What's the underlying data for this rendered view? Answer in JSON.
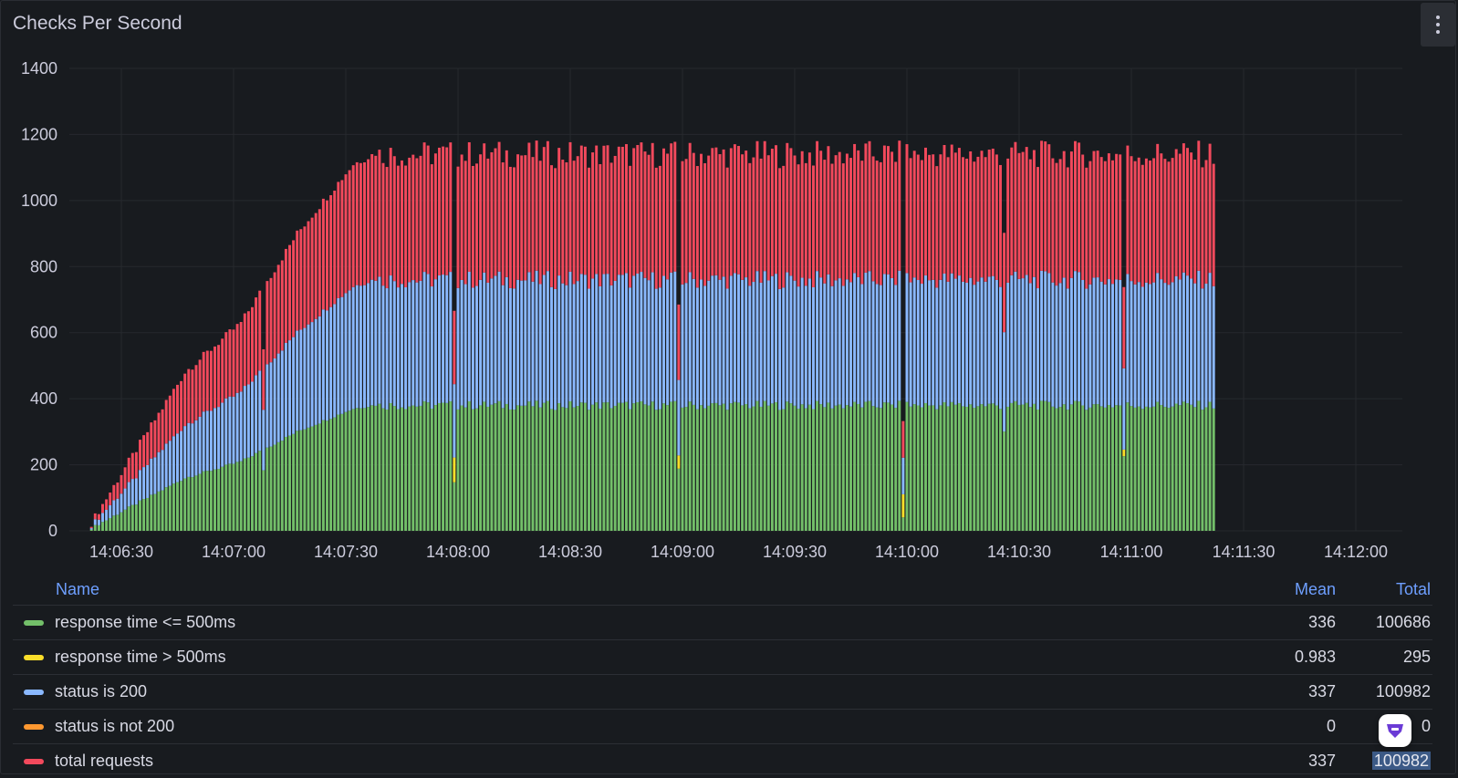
{
  "panel": {
    "title": "Checks Per Second"
  },
  "colors": {
    "green": "#73bf69",
    "yellow": "#fade2a",
    "blue": "#8ab8ff",
    "orange": "#ff9830",
    "red": "#f2495c",
    "accent": "#6e9fff"
  },
  "icons": {
    "menu": "vertical-ellipsis-icon",
    "assistant": "assistant-logo-icon"
  },
  "chart_data": {
    "type": "bar",
    "stacked": true,
    "x_ticks": [
      "14:06:30",
      "14:07:00",
      "14:07:30",
      "14:08:00",
      "14:08:30",
      "14:09:00",
      "14:09:30",
      "14:10:00",
      "14:10:30",
      "14:11:00",
      "14:11:30",
      "14:12:00"
    ],
    "y_ticks": [
      "0",
      "200",
      "400",
      "600",
      "800",
      "1000",
      "1200",
      "1400"
    ],
    "ylim": [
      0,
      1400
    ],
    "grid": true,
    "bucket_seconds": 1,
    "start_time": "14:06:22",
    "end_time": "14:11:22",
    "series": [
      {
        "name": "response time <= 500ms",
        "color": "#73bf69",
        "ramp": [
          [
            0,
            8
          ],
          [
            10,
            70
          ],
          [
            25,
            160
          ],
          [
            40,
            210
          ],
          [
            55,
            300
          ],
          [
            70,
            370
          ],
          [
            78,
            385
          ]
        ],
        "plateau": 380
      },
      {
        "name": "response time > 500ms",
        "color": "#fade2a",
        "spikes": [
          [
            97,
            75
          ],
          [
            157,
            40
          ],
          [
            217,
            70
          ],
          [
            276,
            20
          ]
        ],
        "plateau": 1
      },
      {
        "name": "status is 200",
        "color": "#8ab8ff",
        "ramp": [
          [
            0,
            8
          ],
          [
            10,
            70
          ],
          [
            25,
            160
          ],
          [
            40,
            210
          ],
          [
            55,
            300
          ],
          [
            70,
            370
          ],
          [
            78,
            385
          ]
        ],
        "plateau": 380
      },
      {
        "name": "status is not 200",
        "color": "#ff9830",
        "plateau": 0
      },
      {
        "name": "total requests",
        "color": "#f2495c",
        "ramp": [
          [
            0,
            8
          ],
          [
            10,
            70
          ],
          [
            25,
            160
          ],
          [
            40,
            210
          ],
          [
            55,
            300
          ],
          [
            70,
            370
          ],
          [
            78,
            385
          ]
        ],
        "plateau": 380
      }
    ]
  },
  "legend": {
    "headers": {
      "name": "Name",
      "mean": "Mean",
      "total": "Total"
    },
    "rows": [
      {
        "name": "response time <= 500ms",
        "mean": "336",
        "total": "100686",
        "color": "#73bf69"
      },
      {
        "name": "response time > 500ms",
        "mean": "0.983",
        "total": "295",
        "color": "#fade2a"
      },
      {
        "name": "status is 200",
        "mean": "337",
        "total": "100982",
        "color": "#8ab8ff"
      },
      {
        "name": "status is not 200",
        "mean": "0",
        "total": "0",
        "color": "#ff9830"
      },
      {
        "name": "total requests",
        "mean": "337",
        "total": "100982",
        "color": "#f2495c"
      }
    ]
  }
}
